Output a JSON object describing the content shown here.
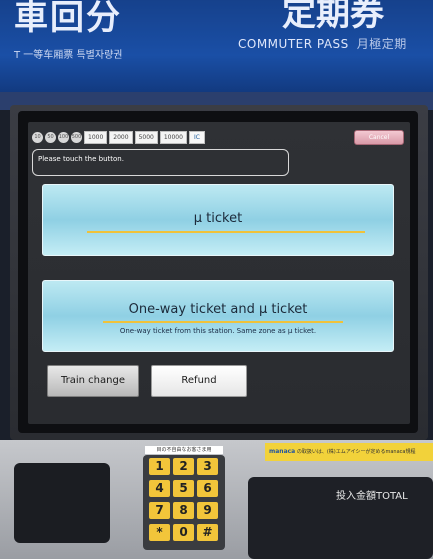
{
  "sign": {
    "left_title": "車回分",
    "left_subtitle": "T 一等车厢票 특별자량권",
    "right_title": "定期券",
    "commuter_pass": "COMMUTER PASS",
    "right_kanji": "月極定期"
  },
  "screen": {
    "payment_options": [
      "1000",
      "2000",
      "5000",
      "10000",
      "IC"
    ],
    "coins": [
      "10",
      "50",
      "100",
      "500"
    ],
    "cancel_label": "Cancel",
    "message": "Please touch the button.",
    "mu_ticket": "μ ticket",
    "oneway_title": "One-way ticket and μ ticket",
    "oneway_desc": "One-way ticket from this station. Same zone as μ ticket.",
    "train_change": "Train change",
    "refund": "Refund"
  },
  "hardware": {
    "keypad_label": "目の不自由なお客さま用",
    "keys": [
      "1",
      "2",
      "3",
      "4",
      "5",
      "6",
      "7",
      "8",
      "9",
      "*",
      "0",
      "#"
    ],
    "manaca_brand": "manaca",
    "manaca_text": "の取扱いは、(株)エムアイシーが定めるmanaca規程",
    "cash_display": "投入金額TOTAL"
  },
  "colors": {
    "button_blue": "#a7def0",
    "underline_gold": "#f0c23a",
    "cancel_pink": "#e3a8b6",
    "keypad_yellow": "#f2c53a"
  }
}
